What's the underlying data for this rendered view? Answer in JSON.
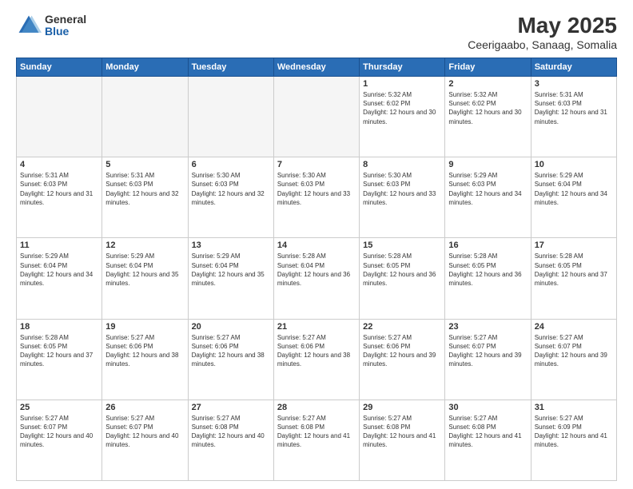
{
  "header": {
    "logo_general": "General",
    "logo_blue": "Blue",
    "main_title": "May 2025",
    "subtitle": "Ceerigaabo, Sanaag, Somalia"
  },
  "days_of_week": [
    "Sunday",
    "Monday",
    "Tuesday",
    "Wednesday",
    "Thursday",
    "Friday",
    "Saturday"
  ],
  "weeks": [
    [
      {
        "day": "",
        "empty": true
      },
      {
        "day": "",
        "empty": true
      },
      {
        "day": "",
        "empty": true
      },
      {
        "day": "",
        "empty": true
      },
      {
        "day": "1",
        "sunrise": "5:32 AM",
        "sunset": "6:02 PM",
        "daylight": "12 hours and 30 minutes."
      },
      {
        "day": "2",
        "sunrise": "5:32 AM",
        "sunset": "6:02 PM",
        "daylight": "12 hours and 30 minutes."
      },
      {
        "day": "3",
        "sunrise": "5:31 AM",
        "sunset": "6:03 PM",
        "daylight": "12 hours and 31 minutes."
      }
    ],
    [
      {
        "day": "4",
        "sunrise": "5:31 AM",
        "sunset": "6:03 PM",
        "daylight": "12 hours and 31 minutes."
      },
      {
        "day": "5",
        "sunrise": "5:31 AM",
        "sunset": "6:03 PM",
        "daylight": "12 hours and 32 minutes."
      },
      {
        "day": "6",
        "sunrise": "5:30 AM",
        "sunset": "6:03 PM",
        "daylight": "12 hours and 32 minutes."
      },
      {
        "day": "7",
        "sunrise": "5:30 AM",
        "sunset": "6:03 PM",
        "daylight": "12 hours and 33 minutes."
      },
      {
        "day": "8",
        "sunrise": "5:30 AM",
        "sunset": "6:03 PM",
        "daylight": "12 hours and 33 minutes."
      },
      {
        "day": "9",
        "sunrise": "5:29 AM",
        "sunset": "6:03 PM",
        "daylight": "12 hours and 34 minutes."
      },
      {
        "day": "10",
        "sunrise": "5:29 AM",
        "sunset": "6:04 PM",
        "daylight": "12 hours and 34 minutes."
      }
    ],
    [
      {
        "day": "11",
        "sunrise": "5:29 AM",
        "sunset": "6:04 PM",
        "daylight": "12 hours and 34 minutes."
      },
      {
        "day": "12",
        "sunrise": "5:29 AM",
        "sunset": "6:04 PM",
        "daylight": "12 hours and 35 minutes."
      },
      {
        "day": "13",
        "sunrise": "5:29 AM",
        "sunset": "6:04 PM",
        "daylight": "12 hours and 35 minutes."
      },
      {
        "day": "14",
        "sunrise": "5:28 AM",
        "sunset": "6:04 PM",
        "daylight": "12 hours and 36 minutes."
      },
      {
        "day": "15",
        "sunrise": "5:28 AM",
        "sunset": "6:05 PM",
        "daylight": "12 hours and 36 minutes."
      },
      {
        "day": "16",
        "sunrise": "5:28 AM",
        "sunset": "6:05 PM",
        "daylight": "12 hours and 36 minutes."
      },
      {
        "day": "17",
        "sunrise": "5:28 AM",
        "sunset": "6:05 PM",
        "daylight": "12 hours and 37 minutes."
      }
    ],
    [
      {
        "day": "18",
        "sunrise": "5:28 AM",
        "sunset": "6:05 PM",
        "daylight": "12 hours and 37 minutes."
      },
      {
        "day": "19",
        "sunrise": "5:27 AM",
        "sunset": "6:06 PM",
        "daylight": "12 hours and 38 minutes."
      },
      {
        "day": "20",
        "sunrise": "5:27 AM",
        "sunset": "6:06 PM",
        "daylight": "12 hours and 38 minutes."
      },
      {
        "day": "21",
        "sunrise": "5:27 AM",
        "sunset": "6:06 PM",
        "daylight": "12 hours and 38 minutes."
      },
      {
        "day": "22",
        "sunrise": "5:27 AM",
        "sunset": "6:06 PM",
        "daylight": "12 hours and 39 minutes."
      },
      {
        "day": "23",
        "sunrise": "5:27 AM",
        "sunset": "6:07 PM",
        "daylight": "12 hours and 39 minutes."
      },
      {
        "day": "24",
        "sunrise": "5:27 AM",
        "sunset": "6:07 PM",
        "daylight": "12 hours and 39 minutes."
      }
    ],
    [
      {
        "day": "25",
        "sunrise": "5:27 AM",
        "sunset": "6:07 PM",
        "daylight": "12 hours and 40 minutes."
      },
      {
        "day": "26",
        "sunrise": "5:27 AM",
        "sunset": "6:07 PM",
        "daylight": "12 hours and 40 minutes."
      },
      {
        "day": "27",
        "sunrise": "5:27 AM",
        "sunset": "6:08 PM",
        "daylight": "12 hours and 40 minutes."
      },
      {
        "day": "28",
        "sunrise": "5:27 AM",
        "sunset": "6:08 PM",
        "daylight": "12 hours and 41 minutes."
      },
      {
        "day": "29",
        "sunrise": "5:27 AM",
        "sunset": "6:08 PM",
        "daylight": "12 hours and 41 minutes."
      },
      {
        "day": "30",
        "sunrise": "5:27 AM",
        "sunset": "6:08 PM",
        "daylight": "12 hours and 41 minutes."
      },
      {
        "day": "31",
        "sunrise": "5:27 AM",
        "sunset": "6:09 PM",
        "daylight": "12 hours and 41 minutes."
      }
    ]
  ],
  "labels": {
    "sunrise_label": "Sunrise:",
    "sunset_label": "Sunset:",
    "daylight_label": "Daylight:"
  }
}
